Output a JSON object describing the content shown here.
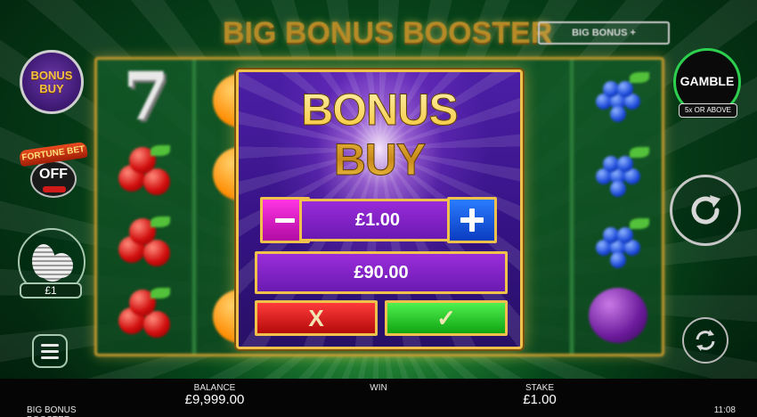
{
  "game": {
    "title": "BIG BONUS BOOSTER",
    "badge": "BIG BONUS +"
  },
  "left_controls": {
    "bonus_buy_line1": "BONUS",
    "bonus_buy_line2": "BUY",
    "fortune_bet_label": "FORTUNE BET",
    "fortune_bet_state": "OFF",
    "coin_value": "£1"
  },
  "right_controls": {
    "gamble_label": "GAMBLE",
    "gamble_sub": "5x OR ABOVE"
  },
  "modal": {
    "title_line1": "BONUS",
    "title_line2": "BUY",
    "stake": "£1.00",
    "cost": "£90.00",
    "cancel_glyph": "X",
    "confirm_glyph": "✓"
  },
  "bottom_bar": {
    "balance_label": "BALANCE",
    "balance_value": "£9,999.00",
    "win_label": "WIN",
    "win_value": "",
    "stake_label": "STAKE",
    "stake_value": "£1.00",
    "game_name": "BIG BONUS BOOSTER",
    "clock": "11:08"
  },
  "colors": {
    "accent_gold": "#f0c24b",
    "modal_purple": "#4c1fa6",
    "cancel_red": "#d41414",
    "confirm_green": "#1fc41f",
    "gamble_ring": "#2ccf4e"
  },
  "icons": {
    "spin": "spin-arrow-icon",
    "autoplay": "autoplay-arrows-icon",
    "menu": "hamburger-icon",
    "coins": "coin-stack-icon"
  },
  "reel_symbols": [
    [
      "seven",
      "cherry",
      "cherry",
      "cherry"
    ],
    [
      "orange",
      "orange",
      "blank",
      "orange"
    ],
    [
      "hidden",
      "hidden",
      "hidden",
      "hidden"
    ],
    [
      "hidden",
      "hidden",
      "hidden",
      "hidden"
    ],
    [
      "hidden",
      "hidden",
      "hidden",
      "hidden"
    ],
    [
      "grapes",
      "grapes",
      "grapes",
      "plum"
    ]
  ]
}
